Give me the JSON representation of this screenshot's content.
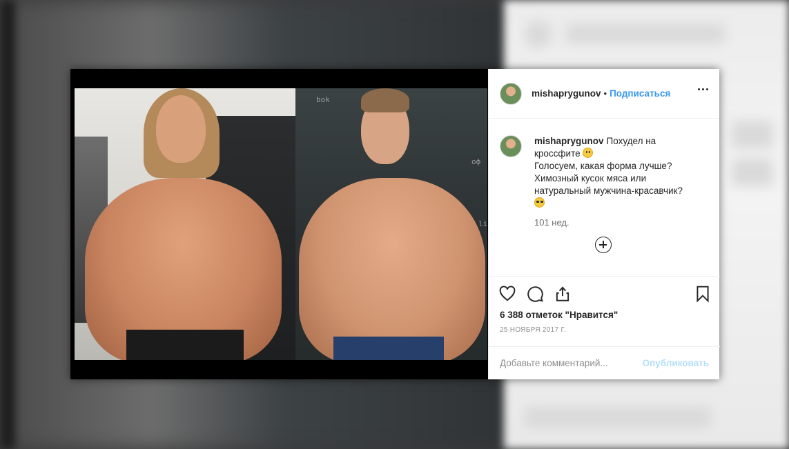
{
  "post": {
    "author": "mishaprygunov",
    "separator": "•",
    "follow_label": "Подписаться",
    "caption_author": "mishaprygunov",
    "caption_lines": [
      "Похудел на",
      "кроссфите",
      "Голосуем, какая форма лучше?",
      "Химозный кусок мяса или",
      "натуральный мужчина-красавчик?"
    ],
    "caption_time": "101 нед.",
    "likes": "6 388 отметок \"Нравится\"",
    "date": "25 НОЯБРЯ 2017 Г.",
    "comment_placeholder": "Добавьте комментарий...",
    "publish_label": "Опубликовать"
  },
  "icons": {
    "more": "more-dots-icon",
    "like": "heart-icon",
    "comment": "speech-bubble-icon",
    "share": "share-icon",
    "save": "bookmark-icon",
    "load_more": "plus-circle-icon"
  },
  "colors": {
    "link": "#3897f0",
    "publish_disabled": "#b2dffc",
    "text": "#262626",
    "muted": "#8e8e8e"
  }
}
